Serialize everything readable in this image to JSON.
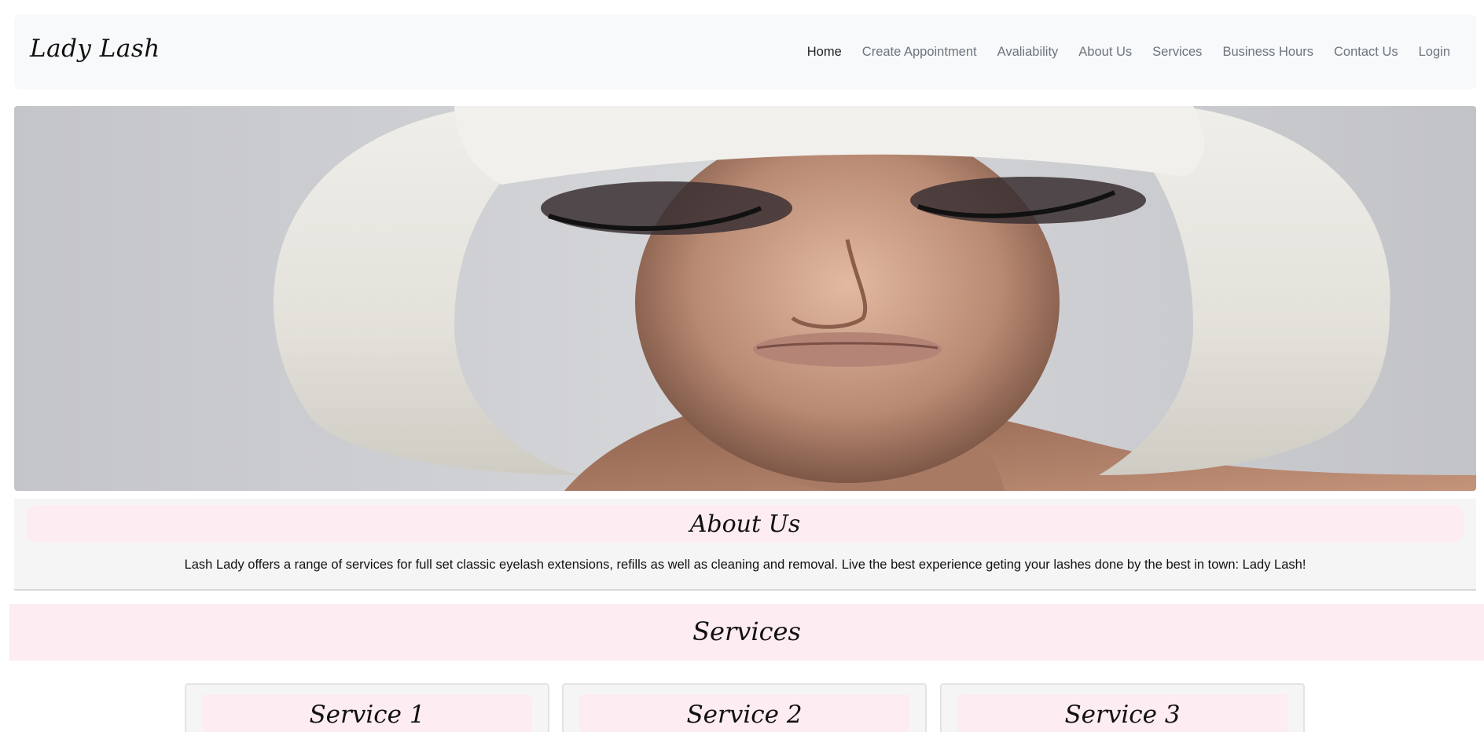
{
  "navbar": {
    "brand": "Lady Lash",
    "links": [
      {
        "label": "Home",
        "active": true
      },
      {
        "label": "Create Appointment",
        "active": false
      },
      {
        "label": "Avaliability",
        "active": false
      },
      {
        "label": "About Us",
        "active": false
      },
      {
        "label": "Services",
        "active": false
      },
      {
        "label": "Business Hours",
        "active": false
      },
      {
        "label": "Contact Us",
        "active": false
      },
      {
        "label": "Login",
        "active": false
      }
    ]
  },
  "about": {
    "heading": "About Us",
    "text": "Lash Lady offers a range of services for full set classic eyelash extensions, refills as well as cleaning and removal. Live the best experience geting your lashes done by the best in town: Lady Lash!"
  },
  "services": {
    "heading": "Services",
    "cards": [
      {
        "title": "Service 1"
      },
      {
        "title": "Service 2"
      },
      {
        "title": "Service 3"
      }
    ]
  },
  "colors": {
    "navbar_bg": "#f8f9fa",
    "pink_band": "#fdecf1",
    "section_bg": "#f5f5f5",
    "nav_link": "#6c757d",
    "nav_link_active": "#212529"
  }
}
